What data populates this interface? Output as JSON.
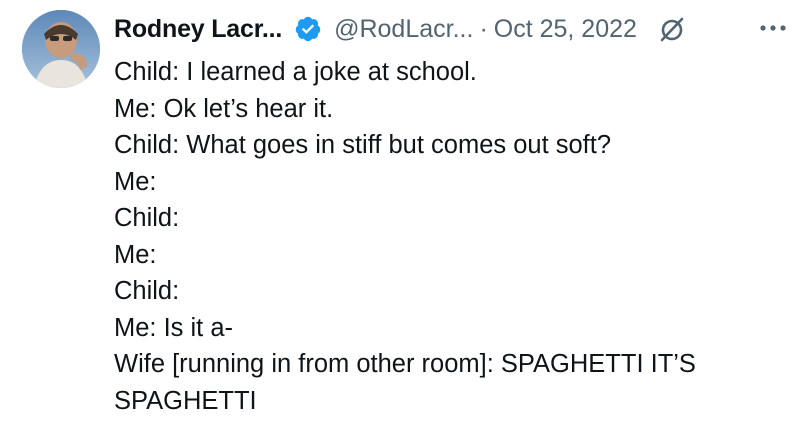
{
  "tweet": {
    "author": {
      "display_name": "Rodney Lacr...",
      "handle": "@RodLacr...",
      "verified": true,
      "avatar_icon": "profile-photo"
    },
    "separator": "·",
    "date": "Oct 25, 2022",
    "grok_icon": "grok-icon",
    "more_icon": "more-dots-icon",
    "lines": [
      "Child: I learned a joke at school.",
      "Me: Ok let’s hear it.",
      "Child: What goes in stiff but comes out soft?",
      "Me:",
      "Child:",
      "Me:",
      "Child:",
      "Me: Is it a-",
      "Wife [running in from other room]: SPAGHETTI IT’S",
      "SPAGHETTI"
    ]
  },
  "colors": {
    "text": "#0f1419",
    "secondary": "#536471",
    "verified_blue": "#1d9bf0"
  }
}
